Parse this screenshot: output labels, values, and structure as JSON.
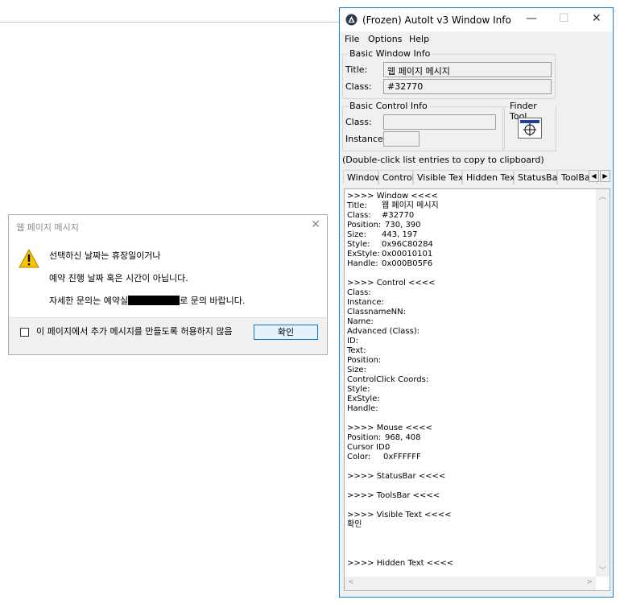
{
  "dialog": {
    "title": "웹 페이지 메시지",
    "line1": "선택하신 날짜는 휴장일이거나",
    "line2": "예약 진행 날짜 혹은 시간이 아닙니다.",
    "line3_prefix": "자세한 문의는 예약실",
    "line3_suffix": "로 문의 바랍니다.",
    "checkbox_label": "이 페이지에서 추가 메시지를 만들도록 허용하지 않음",
    "ok_label": "확인"
  },
  "autoit": {
    "title": "(Frozen) AutoIt v3 Window Info",
    "menu": [
      "File",
      "Options",
      "Help"
    ],
    "basic_window": {
      "group_label": "Basic Window Info",
      "title_label": "Title:",
      "title_value": "웹 페이지 메시지",
      "class_label": "Class:",
      "class_value": "#32770"
    },
    "basic_control": {
      "group_label": "Basic Control Info",
      "class_label": "Class:",
      "class_value": "",
      "instance_label": "Instance:",
      "instance_value": ""
    },
    "finder": {
      "label": "Finder Tool"
    },
    "hint": "(Double-click list entries to copy to clipboard)",
    "tabs": [
      "Window",
      "Control",
      "Visible Text",
      "Hidden Text",
      "StatusBar",
      "ToolBa"
    ],
    "list": [
      [
        ">>>> Window <<<<",
        ""
      ],
      [
        "Title:",
        "웹 페이지 메시지"
      ],
      [
        "Class:",
        "#32770"
      ],
      [
        "Position:",
        "730, 390"
      ],
      [
        "Size:",
        "443, 197"
      ],
      [
        "Style:",
        "0x96C80284"
      ],
      [
        "ExStyle:",
        "0x00010101"
      ],
      [
        "Handle:",
        "0x000B05F6"
      ],
      [
        "",
        ""
      ],
      [
        ">>>> Control <<<<",
        ""
      ],
      [
        "Class:",
        ""
      ],
      [
        "Instance:",
        ""
      ],
      [
        "ClassnameNN:",
        ""
      ],
      [
        "Name:",
        ""
      ],
      [
        "Advanced (Class):",
        ""
      ],
      [
        "ID:",
        ""
      ],
      [
        "Text:",
        ""
      ],
      [
        "Position:",
        ""
      ],
      [
        "Size:",
        ""
      ],
      [
        "ControlClick Coords:",
        ""
      ],
      [
        "Style:",
        ""
      ],
      [
        "ExStyle:",
        ""
      ],
      [
        "Handle:",
        ""
      ],
      [
        "",
        ""
      ],
      [
        ">>>> Mouse <<<<",
        ""
      ],
      [
        "Position:",
        "968, 408"
      ],
      [
        "Cursor ID:",
        "0"
      ],
      [
        "Color:",
        "0xFFFFFF"
      ],
      [
        "",
        ""
      ],
      [
        ">>>> StatusBar <<<<",
        ""
      ],
      [
        "",
        ""
      ],
      [
        ">>>> ToolsBar <<<<",
        ""
      ],
      [
        "",
        ""
      ],
      [
        ">>>> Visible Text <<<<",
        ""
      ],
      [
        "확인",
        ""
      ],
      [
        "",
        ""
      ],
      [
        "",
        ""
      ],
      [
        "",
        ""
      ],
      [
        ">>>> Hidden Text <<<<",
        ""
      ]
    ]
  }
}
